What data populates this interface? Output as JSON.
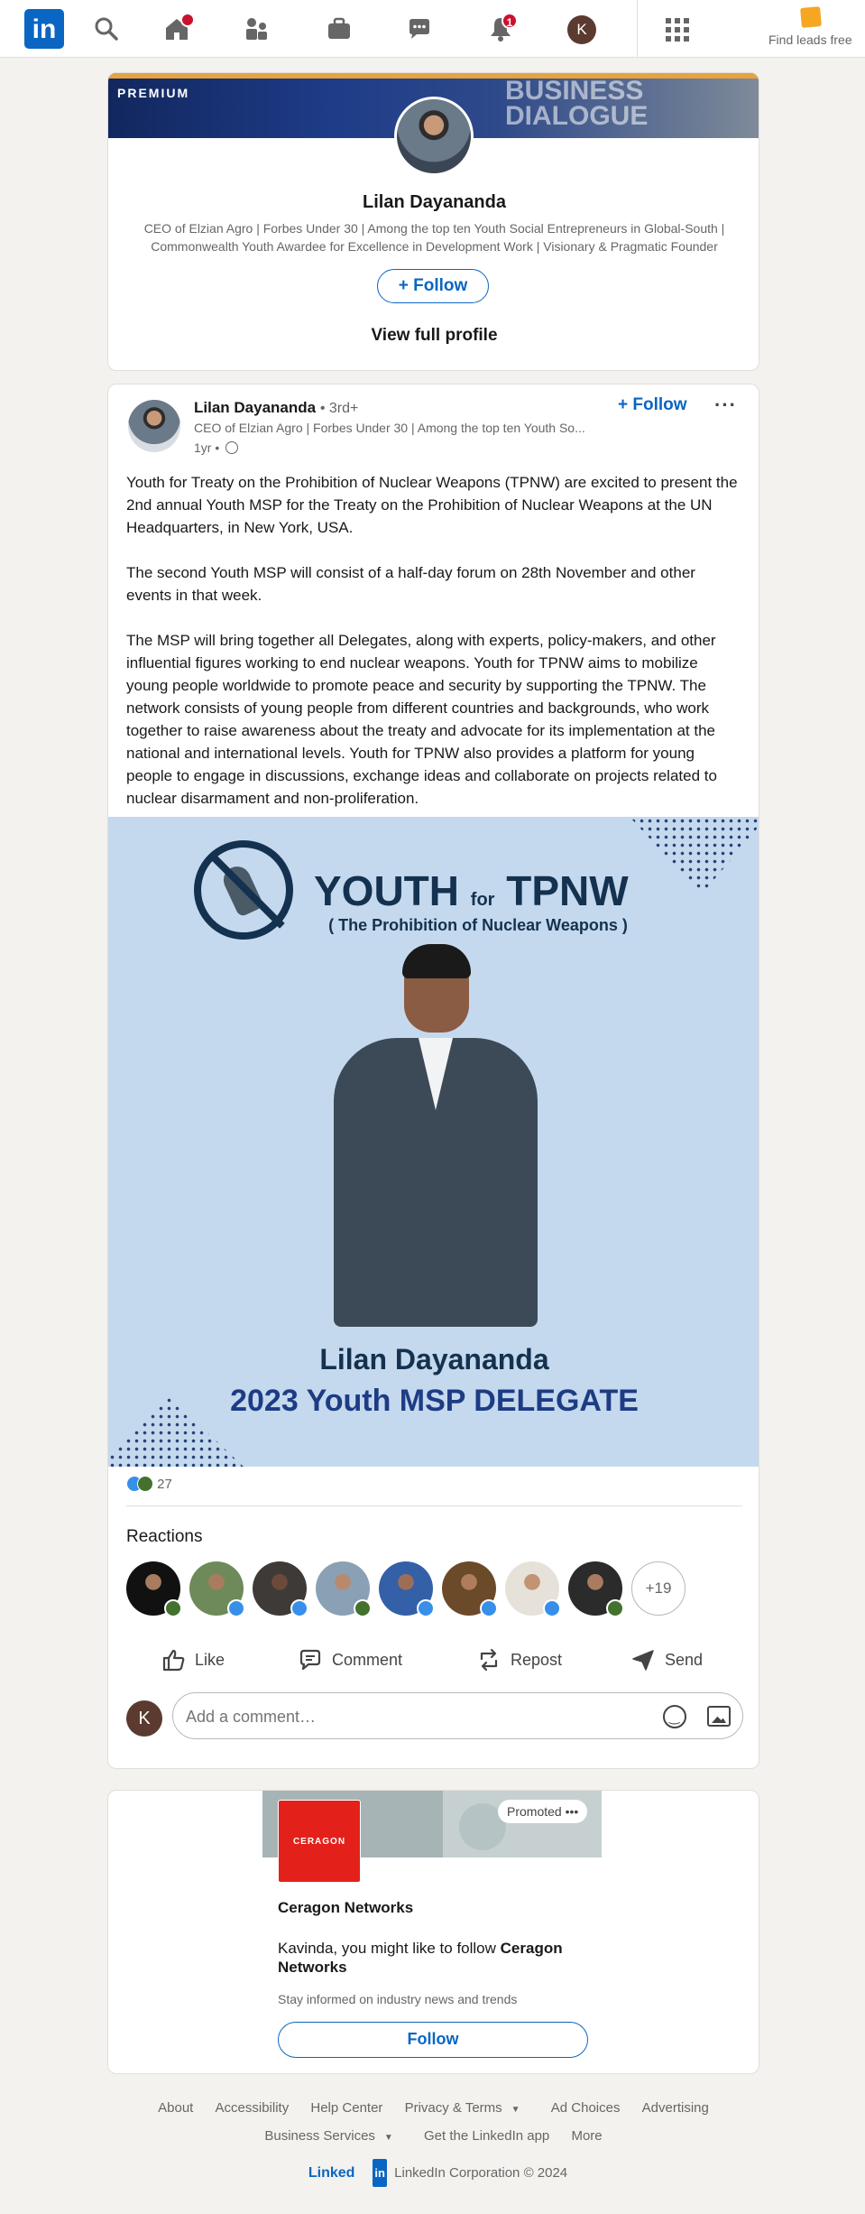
{
  "nav": {
    "logo_text": "in",
    "notifications_badge": "1",
    "avatar_initial": "K",
    "find_leads": "Find leads free"
  },
  "profile_card": {
    "premium": "PREMIUM",
    "banner_text_line1": "BUSINESS",
    "banner_text_line2": "DIALOGUE",
    "name": "Lilan Dayananda",
    "headline": "CEO of Elzian Agro | Forbes Under 30 | Among the top ten Youth Social Entrepreneurs in Global-South | Commonwealth Youth Awardee for Excellence in Development Work | Visionary & Pragmatic Founder",
    "follow_label": "Follow",
    "view_profile_label": "View full profile"
  },
  "post": {
    "author": "Lilan Dayananda",
    "degree": "• 3rd+",
    "headline": "CEO of Elzian Agro | Forbes Under 30 | Among the top ten Youth So...",
    "time": "1yr •",
    "follow_label": "Follow",
    "more_label": "···",
    "body": [
      "Youth for Treaty on the Prohibition of Nuclear Weapons (TPNW) are excited to present the 2nd annual Youth MSP for the Treaty on the Prohibition of Nuclear Weapons at the UN Headquarters, in New York, USA.",
      "The second Youth MSP will consist of a half-day forum on 28th November and other events in that week.",
      "The MSP will bring together all Delegates, along with experts, policy-makers, and other influential figures working to end nuclear weapons. Youth for TPNW aims to mobilize young people worldwide to promote peace and security by supporting the TPNW. The network consists of young people from different countries and backgrounds, who work together to raise awareness about the treaty and advocate for its implementation at the national and international levels. Youth for TPNW also provides a platform for young people to engage in discussions, exchange ideas and collaborate on projects related to nuclear disarmament and non-proliferation."
    ],
    "image": {
      "title_youth": "YOUTH",
      "title_for": "for",
      "title_tpnw": "TPNW",
      "subtitle": "( The Prohibition of Nuclear Weapons )",
      "name": "Lilan Dayananda",
      "delegate": "2023 Youth MSP DELEGATE"
    },
    "reaction_count": "27",
    "reactions_heading": "Reactions",
    "more_reactors": "+19",
    "actions": {
      "like": "Like",
      "comment": "Comment",
      "repost": "Repost",
      "send": "Send"
    },
    "comment_avatar_initial": "K",
    "comment_placeholder": "Add a comment…"
  },
  "ad": {
    "promoted": "Promoted",
    "promoted_more": "•••",
    "logo_text": "CERAGON",
    "company": "Ceragon Networks",
    "message_prefix": "Kavinda, you might like to follow",
    "message_company": "Ceragon Networks",
    "tagline": "Stay informed on industry news and trends",
    "follow_label": "Follow"
  },
  "footer": {
    "row1": [
      "About",
      "Accessibility",
      "Help Center",
      "Privacy & Terms",
      "Ad Choices",
      "Advertising"
    ],
    "row2": [
      "Business Services",
      "Get the LinkedIn app",
      "More"
    ],
    "brand_linked": "Linked",
    "brand_in": "in",
    "copyright": "LinkedIn Corporation © 2024"
  },
  "colors": {
    "linkedin_blue": "#0a66c2",
    "notification_red": "#cb112d",
    "page_background": "#f4f2ee",
    "poster_background": "#c5d9ee",
    "poster_navy": "#14324f",
    "ceragon_red": "#e3211a"
  }
}
